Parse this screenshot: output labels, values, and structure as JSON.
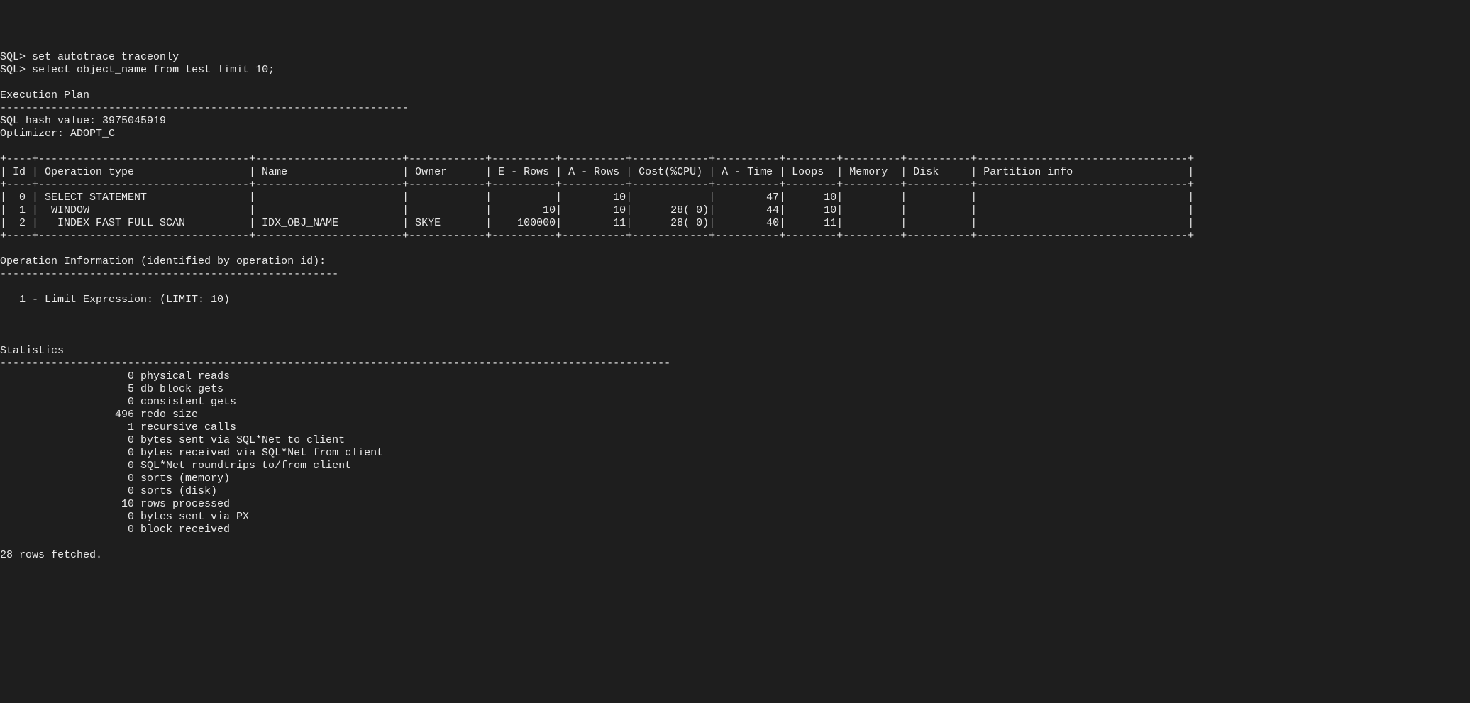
{
  "prompt": "SQL>",
  "commands": [
    "set autotrace traceonly",
    "select object_name from test limit 10;"
  ],
  "exec_plan_header": "Execution Plan",
  "sql_hash_label": "SQL hash value:",
  "sql_hash_value": "3975045919",
  "optimizer_label": "Optimizer:",
  "optimizer_value": "ADOPT_C",
  "plan_columns": [
    "Id",
    "Operation type",
    "Name",
    "Owner",
    "E - Rows",
    "A - Rows",
    "Cost(%CPU)",
    "A - Time",
    "Loops",
    "Memory",
    "Disk",
    "Partition info"
  ],
  "plan_rows": [
    {
      "id": "0",
      "op": "SELECT STATEMENT",
      "name": "",
      "owner": "",
      "erows": "",
      "arows": "10",
      "cost": "",
      "atime": "47",
      "loops": "10",
      "memory": "",
      "disk": "",
      "part": ""
    },
    {
      "id": "1",
      "op": " WINDOW",
      "name": "",
      "owner": "",
      "erows": "10",
      "arows": "10",
      "cost": "28( 0)",
      "atime": "44",
      "loops": "10",
      "memory": "",
      "disk": "",
      "part": ""
    },
    {
      "id": "2",
      "op": "  INDEX FAST FULL SCAN",
      "name": "IDX_OBJ_NAME",
      "owner": "SKYE",
      "erows": "100000",
      "arows": "11",
      "cost": "28( 0)",
      "atime": "40",
      "loops": "11",
      "memory": "",
      "disk": "",
      "part": ""
    }
  ],
  "op_info_header": "Operation Information (identified by operation id):",
  "op_info_lines": [
    "   1 - Limit Expression: (LIMIT: 10)"
  ],
  "stats_header": "Statistics",
  "stats": [
    {
      "val": "0",
      "label": "physical reads"
    },
    {
      "val": "5",
      "label": "db block gets"
    },
    {
      "val": "0",
      "label": "consistent gets"
    },
    {
      "val": "496",
      "label": "redo size"
    },
    {
      "val": "1",
      "label": "recursive calls"
    },
    {
      "val": "0",
      "label": "bytes sent via SQL*Net to client"
    },
    {
      "val": "0",
      "label": "bytes received via SQL*Net from client"
    },
    {
      "val": "0",
      "label": "SQL*Net roundtrips to/from client"
    },
    {
      "val": "0",
      "label": "sorts (memory)"
    },
    {
      "val": "0",
      "label": "sorts (disk)"
    },
    {
      "val": "10",
      "label": "rows processed"
    },
    {
      "val": "0",
      "label": "bytes sent via PX"
    },
    {
      "val": "0",
      "label": "block received"
    }
  ],
  "footer": "28 rows fetched."
}
